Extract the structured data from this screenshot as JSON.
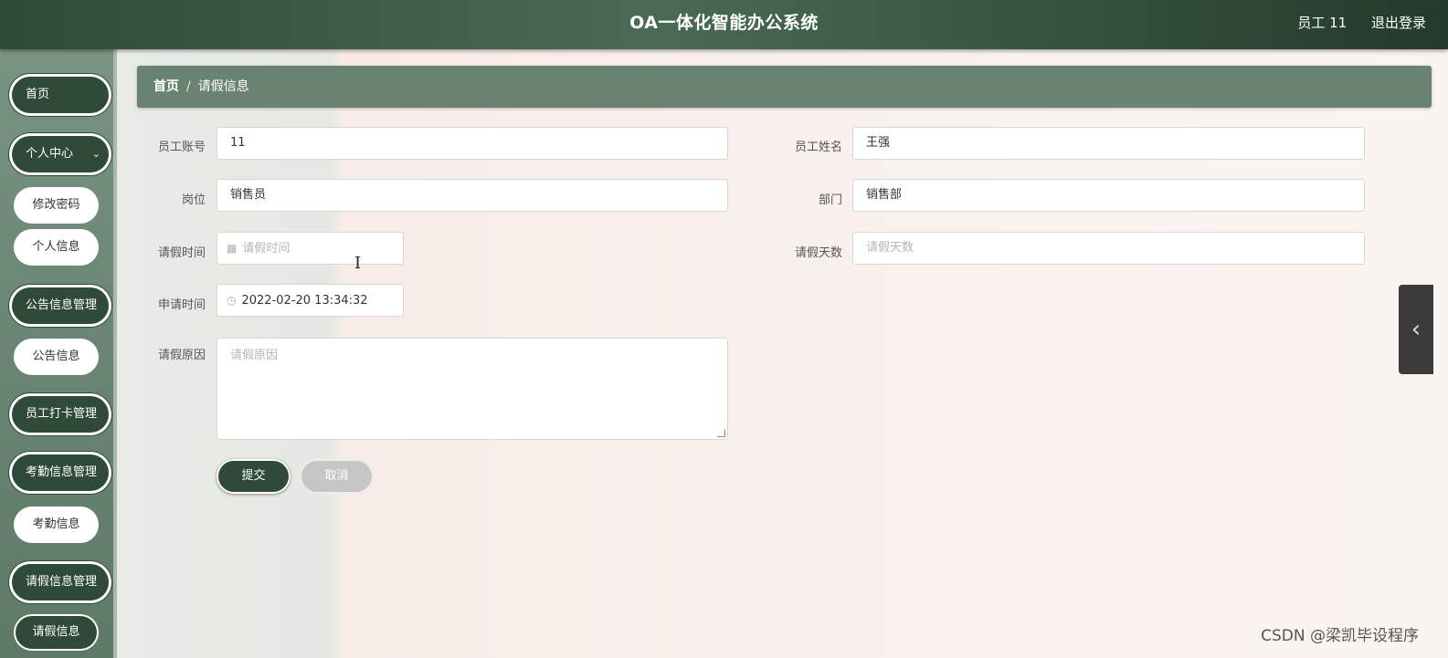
{
  "header": {
    "title": "OA一体化智能办公系统",
    "user": "员工 11",
    "logout": "退出登录"
  },
  "sidebar": {
    "home": "首页",
    "personal_center": "个人中心",
    "change_password": "修改密码",
    "personal_info": "个人信息",
    "notice_mgmt": "公告信息管理",
    "notice_info": "公告信息",
    "clockin_mgmt": "员工打卡管理",
    "attendance_mgmt": "考勤信息管理",
    "attendance_info": "考勤信息",
    "leave_mgmt": "请假信息管理",
    "leave_info": "请假信息"
  },
  "breadcrumb": {
    "home": "首页",
    "separator": "/",
    "current": "请假信息"
  },
  "form": {
    "emp_account_label": "员工账号",
    "emp_account_value": "11",
    "emp_name_label": "员工姓名",
    "emp_name_value": "王强",
    "position_label": "岗位",
    "position_value": "销售员",
    "dept_label": "部门",
    "dept_value": "销售部",
    "leave_time_label": "请假时间",
    "leave_time_placeholder": "请假时间",
    "leave_days_label": "请假天数",
    "leave_days_placeholder": "请假天数",
    "apply_time_label": "申请时间",
    "apply_time_value": "2022-02-20 13:34:32",
    "reason_label": "请假原因",
    "reason_placeholder": "请假原因"
  },
  "buttons": {
    "submit": "提交",
    "cancel": "取消"
  },
  "icons": {
    "calendar": "calendar-icon",
    "clock": "clock-icon",
    "chevron": "chevron-left-icon"
  },
  "watermark": "CSDN @梁凯毕设程序",
  "colors": {
    "accent": "#2f4a38",
    "breadcrumb_bg": "#6a8271"
  }
}
